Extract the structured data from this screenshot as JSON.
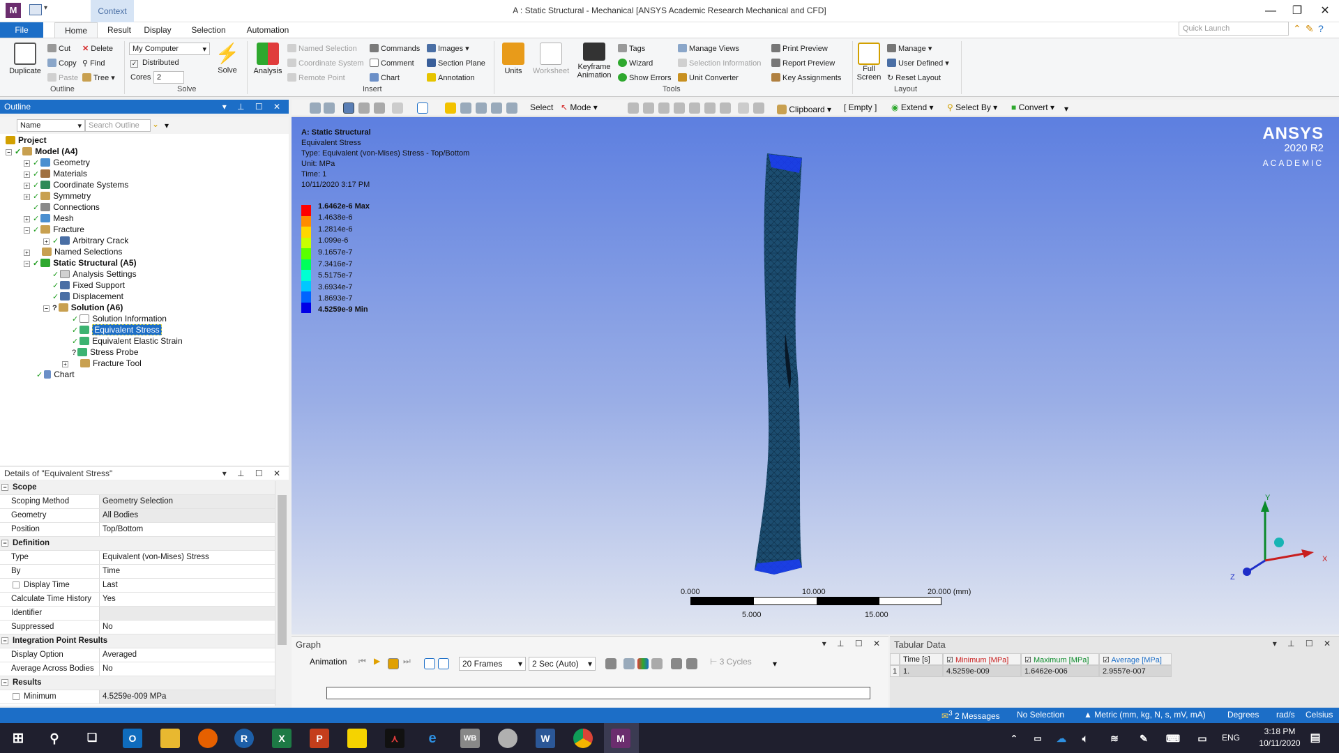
{
  "window": {
    "title": "A : Static Structural - Mechanical [ANSYS Academic Research Mechanical and CFD]",
    "app_icon_letter": "M",
    "context_tab": "Context"
  },
  "tabs": [
    "File",
    "Home",
    "Result",
    "Display",
    "Selection",
    "Automation"
  ],
  "quick_launch_placeholder": "Quick Launch",
  "ribbon": {
    "outline": {
      "duplicate": "Duplicate",
      "cut": "Cut",
      "copy": "Copy",
      "paste": "Paste",
      "delete": "Delete",
      "find": "Find",
      "tree": "Tree",
      "label": "Outline"
    },
    "solve": {
      "computer": "My Computer",
      "distributed": "Distributed",
      "cores_label": "Cores",
      "cores_value": "2",
      "solve": "Solve",
      "label": "Solve"
    },
    "insert": {
      "analysis": "Analysis",
      "named_selection": "Named Selection",
      "coordinate_system": "Coordinate System",
      "remote_point": "Remote Point",
      "commands": "Commands",
      "comment": "Comment",
      "chart": "Chart",
      "images": "Images",
      "section_plane": "Section Plane",
      "annotation": "Annotation",
      "label": "Insert"
    },
    "tools": {
      "units": "Units",
      "worksheet": "Worksheet",
      "keyframe_1": "Keyframe",
      "keyframe_2": "Animation",
      "tags": "Tags",
      "wizard": "Wizard",
      "show_errors": "Show Errors",
      "manage_views": "Manage Views",
      "selection_information": "Selection Information",
      "unit_converter": "Unit Converter",
      "print_preview": "Print Preview",
      "report_preview": "Report Preview",
      "key_assignments": "Key Assignments",
      "label": "Tools"
    },
    "layout": {
      "full_1": "Full",
      "full_2": "Screen",
      "manage": "Manage",
      "user_defined": "User Defined",
      "reset_layout": "Reset Layout",
      "label": "Layout"
    }
  },
  "outline": {
    "title": "Outline",
    "filter": "Name",
    "search_placeholder": "Search Outline",
    "nodes": [
      {
        "label": "Project"
      },
      {
        "label": "Model (A4)"
      },
      {
        "label": "Geometry"
      },
      {
        "label": "Materials"
      },
      {
        "label": "Coordinate Systems"
      },
      {
        "label": "Symmetry"
      },
      {
        "label": "Connections"
      },
      {
        "label": "Mesh"
      },
      {
        "label": "Fracture"
      },
      {
        "label": "Arbitrary Crack"
      },
      {
        "label": "Named Selections"
      },
      {
        "label": "Static Structural (A5)"
      },
      {
        "label": "Analysis Settings"
      },
      {
        "label": "Fixed Support"
      },
      {
        "label": "Displacement"
      },
      {
        "label": "Solution (A6)"
      },
      {
        "label": "Solution Information"
      },
      {
        "label": "Equivalent Stress"
      },
      {
        "label": "Equivalent Elastic Strain"
      },
      {
        "label": "Stress Probe"
      },
      {
        "label": "Fracture Tool"
      },
      {
        "label": "Chart"
      }
    ]
  },
  "details": {
    "title": "Details of \"Equivalent Stress\"",
    "rows": [
      {
        "k": "Scope",
        "v": ""
      },
      {
        "k": "Scoping Method",
        "v": "Geometry Selection"
      },
      {
        "k": "Geometry",
        "v": "All Bodies"
      },
      {
        "k": "Position",
        "v": "Top/Bottom"
      },
      {
        "k": "Definition",
        "v": ""
      },
      {
        "k": "Type",
        "v": "Equivalent (von-Mises) Stress"
      },
      {
        "k": "By",
        "v": "Time"
      },
      {
        "k": "Display Time",
        "v": "Last"
      },
      {
        "k": "Calculate Time History",
        "v": "Yes"
      },
      {
        "k": "Identifier",
        "v": ""
      },
      {
        "k": "Suppressed",
        "v": "No"
      },
      {
        "k": "Integration Point Results",
        "v": ""
      },
      {
        "k": "Display Option",
        "v": "Averaged"
      },
      {
        "k": "Average Across Bodies",
        "v": "No"
      },
      {
        "k": "Results",
        "v": ""
      },
      {
        "k": "Minimum",
        "v": "4.5259e-009 MPa"
      }
    ]
  },
  "viewport_toolbar": {
    "select": "Select",
    "mode": "Mode",
    "clipboard": "Clipboard",
    "empty": "[ Empty ]",
    "extend": "Extend",
    "select_by": "Select By",
    "convert": "Convert"
  },
  "viewport": {
    "info": [
      "A: Static Structural",
      "Equivalent Stress",
      "Type: Equivalent (von-Mises) Stress - Top/Bottom",
      "Unit: MPa",
      "Time: 1",
      "10/11/2020 3:17 PM"
    ],
    "legend": [
      "1.6462e-6 Max",
      "1.4638e-6",
      "1.2814e-6",
      "1.099e-6",
      "9.1657e-7",
      "7.3416e-7",
      "5.5175e-7",
      "3.6934e-7",
      "1.8693e-7",
      "4.5259e-9 Min"
    ],
    "legend_colors": [
      "#ff0000",
      "#ff8c00",
      "#ffd700",
      "#c8ff00",
      "#5aff00",
      "#00ff5a",
      "#00ffd2",
      "#00c8ff",
      "#0064ff",
      "#0000e6"
    ],
    "logo_main": "ANSYS",
    "logo_year": "2020 R2",
    "logo_sub": "ACADEMIC",
    "scale_top": [
      "0.000",
      "10.000",
      "20.000 (mm)"
    ],
    "scale_bottom": [
      "5.000",
      "15.000"
    ],
    "triad": {
      "y": "Y",
      "x": "X",
      "z": "Z"
    }
  },
  "graph": {
    "title": "Graph",
    "animation": "Animation",
    "frames": "20 Frames",
    "duration": "2 Sec (Auto)",
    "cycles": "3 Cycles"
  },
  "tabular": {
    "title": "Tabular Data",
    "headers": [
      "Time [s]",
      "Minimum [MPa]",
      "Maximum [MPa]",
      "Average [MPa]"
    ],
    "row_index": "1",
    "row": [
      "1.",
      "4.5259e-009",
      "1.6462e-006",
      "2.9557e-007"
    ]
  },
  "statusbar": {
    "messages": "2 Messages",
    "messages_count": "3",
    "selection": "No Selection",
    "units": "Metric (mm, kg, N, s, mV, mA)",
    "angle": "Degrees",
    "rate": "rad/s",
    "temp": "Celsius"
  },
  "taskbar": {
    "time": "3:18 PM",
    "date": "10/11/2020",
    "lang": "ENG",
    "apps": [
      "Outlook",
      "File Explorer",
      "Firefox",
      "R",
      "Excel",
      "PowerPoint",
      "Sticky Notes",
      "Acrobat",
      "Internet Explorer",
      "Workbench",
      "Maple",
      "Word",
      "Chrome",
      "Mechanical"
    ],
    "app_letters": {
      "r": "R",
      "excel": "X",
      "ppt": "P",
      "wb": "WB",
      "word": "W",
      "mech": "M"
    }
  }
}
